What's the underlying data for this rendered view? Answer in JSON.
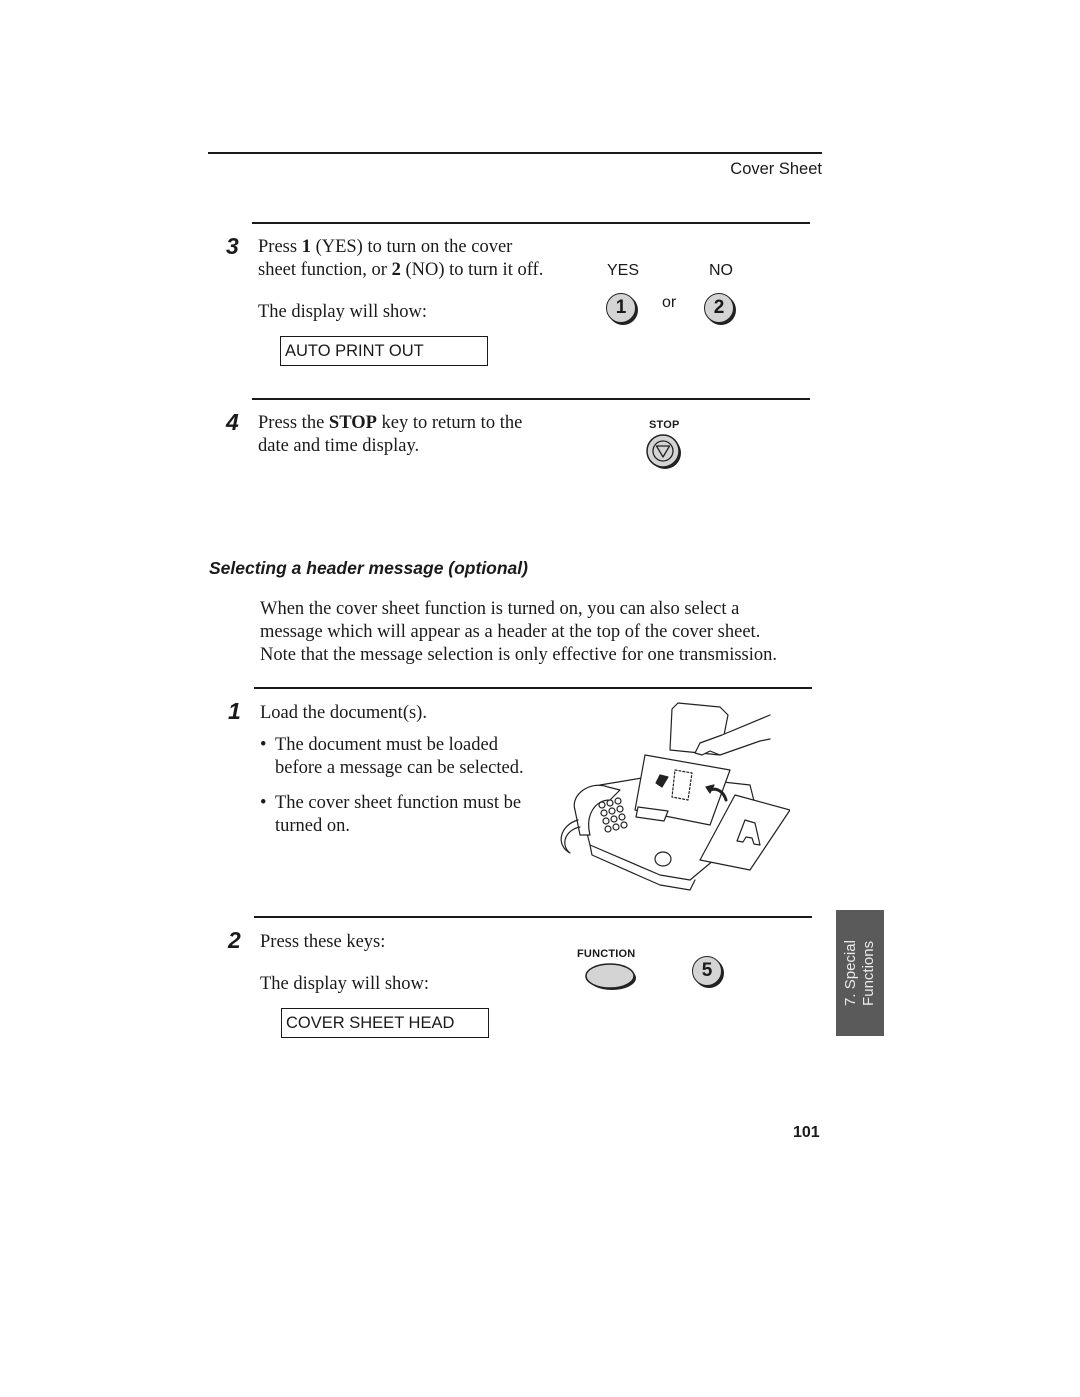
{
  "header": {
    "section_title": "Cover Sheet"
  },
  "step3": {
    "number": "3",
    "line1_a": "Press ",
    "line1_bold": "1",
    "line1_b": " (YES) to turn on the cover",
    "line2_a": "sheet function, or ",
    "line2_bold": "2",
    "line2_b": " (NO) to turn it off.",
    "display_intro": "The display will show:",
    "display_value": "AUTO PRINT OUT",
    "yes_label": "YES",
    "no_label": "NO",
    "or_label": "or",
    "key_yes": "1",
    "key_no": "2"
  },
  "step4": {
    "number": "4",
    "line1_a": "Press the ",
    "line1_bold": "STOP",
    "line1_b": " key to return to the",
    "line2": "date and time display.",
    "stop_label": "STOP",
    "stop_icon": "stop-triangle-icon"
  },
  "section": {
    "heading": "Selecting a header message (optional)",
    "intro_lines": [
      "When the cover sheet function is turned on, you can also select a",
      "message which will appear as a header at the top of the cover sheet.",
      "Note that the message selection is only effective for one transmission."
    ]
  },
  "step1": {
    "number": "1",
    "text": "Load the document(s).",
    "bullets": [
      {
        "line1": "The document must be loaded",
        "line2": "before a message can be selected."
      },
      {
        "line1": "The cover sheet function must be",
        "line2": "turned on."
      }
    ],
    "illustration": "fax-machine-loading-document-illustration"
  },
  "step2": {
    "number": "2",
    "text": "Press these keys:",
    "display_intro": "The display will show:",
    "display_value": "COVER SHEET HEAD",
    "function_label": "FUNCTION",
    "key_5": "5"
  },
  "side_tab": {
    "line1": "7. Special",
    "line2": "Functions",
    "color": "#5a5a5a"
  },
  "footer": {
    "page_number": "101"
  }
}
